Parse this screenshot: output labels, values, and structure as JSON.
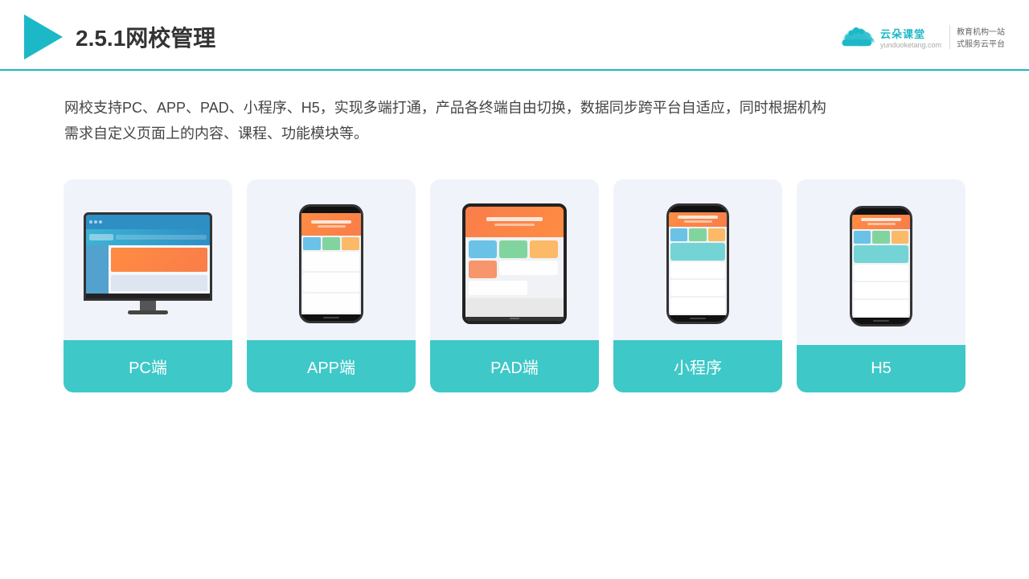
{
  "header": {
    "title": "2.5.1网校管理",
    "logo_main": "云朵课堂",
    "logo_url": "yunduoketang.com",
    "logo_tagline_line1": "教育机构一站",
    "logo_tagline_line2": "式服务云平台"
  },
  "description": {
    "text1": "网校支持PC、APP、PAD、小程序、H5，实现多端打通，产品各终端自由切换，数据同步跨平台自适应，同时根据机构",
    "text2": "需求自定义页面上的内容、课程、功能模块等。"
  },
  "cards": [
    {
      "id": "pc",
      "label": "PC端"
    },
    {
      "id": "app",
      "label": "APP端"
    },
    {
      "id": "pad",
      "label": "PAD端"
    },
    {
      "id": "mini",
      "label": "小程序"
    },
    {
      "id": "h5",
      "label": "H5"
    }
  ]
}
